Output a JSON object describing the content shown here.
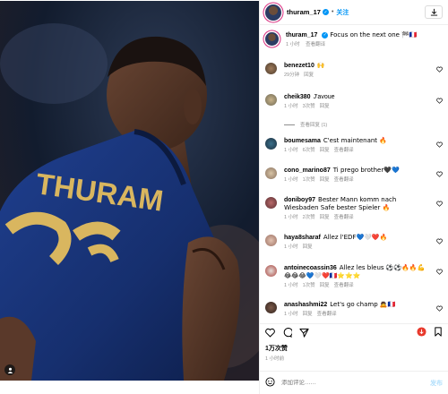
{
  "post": {
    "username": "thuram_17",
    "follow_label": "关注",
    "caption_text": "Focus on the next one 🏁🇫🇷",
    "caption_time": "1 小时",
    "see_translation": "查看翻译",
    "jersey_name": "THURAM"
  },
  "comments": [
    {
      "user": "benezet10",
      "text": "🙌",
      "time": "29分钟",
      "likes": "",
      "reply": "回复",
      "translate": ""
    },
    {
      "user": "cheik380",
      "text": "J'avoue",
      "time": "1 小时",
      "likes": "3次赞",
      "reply": "回复",
      "translate": "",
      "replies": "查看回复 (1)"
    },
    {
      "user": "boumesama",
      "text": "C'est maintenant 🔥",
      "time": "1 小时",
      "likes": "6次赞",
      "reply": "回复",
      "translate": "查看翻译"
    },
    {
      "user": "cono_marino87",
      "text": "Ti prego brother🖤💙",
      "time": "1 小时",
      "likes": "1次赞",
      "reply": "回复",
      "translate": "查看翻译"
    },
    {
      "user": "doniboy97",
      "text": "Bester Mann komm nach Wiesbaden Safe bester Spieler 🔥",
      "time": "1 小时",
      "likes": "2次赞",
      "reply": "回复",
      "translate": "查看翻译"
    },
    {
      "user": "haya8sharaf",
      "text": "Allez l'EDF💙🤍❤️🔥",
      "time": "1 小时",
      "likes": "",
      "reply": "回复",
      "translate": ""
    },
    {
      "user": "antoinecoassin36",
      "text": "Allez les bleus ⚽⚽🔥🔥💪😂😂😂💙🤍❤️🇫🇷⭐⭐⭐",
      "time": "1 小时",
      "likes": "1次赞",
      "reply": "回复",
      "translate": "查看翻译"
    },
    {
      "user": "anashashmi22",
      "text": "Let's go champ 🙇🇫🇷",
      "time": "1 小时",
      "likes": "",
      "reply": "回复",
      "translate": "查看翻译"
    }
  ],
  "footer": {
    "likes": "1万次赞",
    "ago": "1 小时前",
    "comment_placeholder": "添加评论……",
    "post_label": "发布"
  }
}
